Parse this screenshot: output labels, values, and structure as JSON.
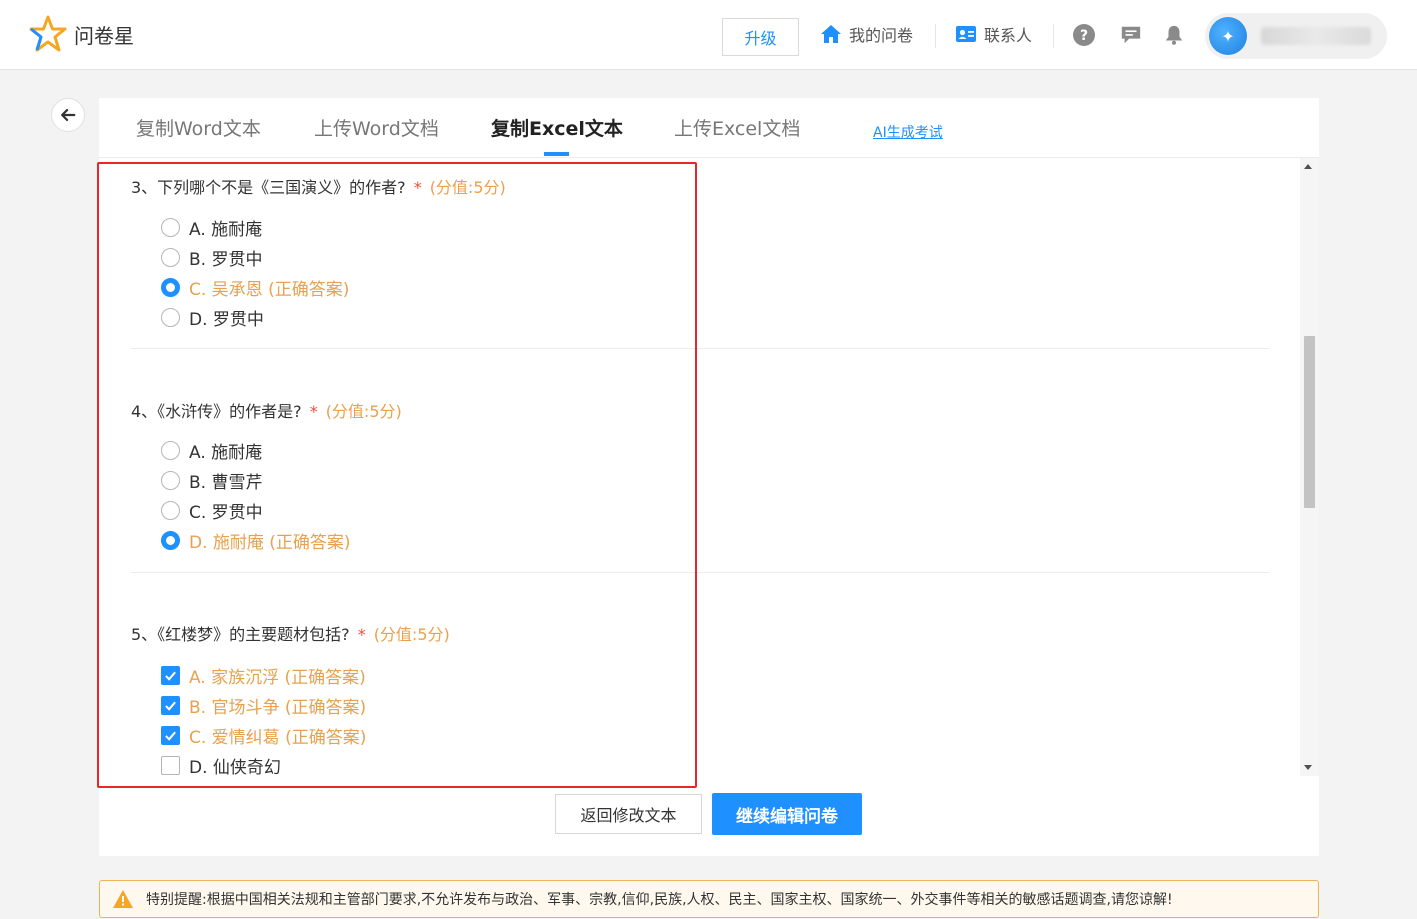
{
  "app": {
    "logo_text": "问卷星"
  },
  "header": {
    "upgrade": "升级",
    "my_surveys": "我的问卷",
    "contacts": "联系人",
    "help_icon": "help-icon",
    "message_icon": "message-icon",
    "bell_icon": "bell-icon"
  },
  "tabs": [
    {
      "label": "复制Word文本",
      "active": false
    },
    {
      "label": "上传Word文档",
      "active": false
    },
    {
      "label": "复制Excel文本",
      "active": true
    },
    {
      "label": "上传Excel文档",
      "active": false
    }
  ],
  "ai_link": "AI生成考试",
  "questions": [
    {
      "title": "3、下列哪个不是《三国演义》的作者?",
      "required": "*",
      "score": "(分值:5分)",
      "type": "radio",
      "options": [
        {
          "label": "A. 施耐庵",
          "checked": false,
          "correct": false
        },
        {
          "label": "B. 罗贯中",
          "checked": false,
          "correct": false
        },
        {
          "label": "C. 吴承恩 (正确答案)",
          "checked": true,
          "correct": true
        },
        {
          "label": "D. 罗贯中",
          "checked": false,
          "correct": false
        }
      ]
    },
    {
      "title": "4、《水浒传》的作者是?",
      "required": "*",
      "score": "(分值:5分)",
      "type": "radio",
      "options": [
        {
          "label": "A. 施耐庵",
          "checked": false,
          "correct": false
        },
        {
          "label": "B. 曹雪芹",
          "checked": false,
          "correct": false
        },
        {
          "label": "C. 罗贯中",
          "checked": false,
          "correct": false
        },
        {
          "label": "D. 施耐庵 (正确答案)",
          "checked": true,
          "correct": true
        }
      ]
    },
    {
      "title": "5、《红楼梦》的主要题材包括?",
      "required": "*",
      "score": "(分值:5分)",
      "type": "checkbox",
      "options": [
        {
          "label": "A. 家族沉浮 (正确答案)",
          "checked": true,
          "correct": true
        },
        {
          "label": "B. 官场斗争 (正确答案)",
          "checked": true,
          "correct": true
        },
        {
          "label": "C. 爱情纠葛 (正确答案)",
          "checked": true,
          "correct": true
        },
        {
          "label": "D. 仙侠奇幻",
          "checked": false,
          "correct": false
        }
      ]
    }
  ],
  "actions": {
    "back_edit": "返回修改文本",
    "continue": "继续编辑问卷"
  },
  "notice": "特别提醒:根据中国相关法规和主管部门要求,不允许发布与政治、军事、宗教,信仰,民族,人权、民主、国家主权、国家统一、外交事件等相关的敏感话题调查,请您谅解!",
  "colors": {
    "accent": "#1e90ff",
    "correct": "#e8a14e",
    "required": "#f04a3a",
    "highlight": "#e8262b"
  }
}
